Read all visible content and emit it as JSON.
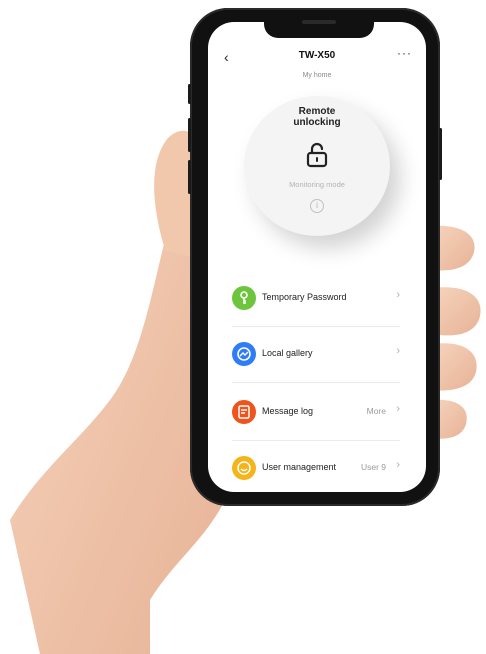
{
  "header": {
    "title": "TW-X50",
    "subtitle": "My home",
    "back_icon": "chevron-left-icon",
    "more_icon": "more-dots-icon"
  },
  "unlock": {
    "title_line1": "Remote",
    "title_line2": "unlocking",
    "status": "Monitoring mode",
    "lock_icon": "unlocked-padlock-icon",
    "info_icon": "info-icon"
  },
  "menu": {
    "items": [
      {
        "label": "Temporary Password",
        "right": "",
        "icon": "key-icon",
        "color": "#6cc53c"
      },
      {
        "label": "Local gallery",
        "right": "",
        "icon": "gallery-icon",
        "color": "#2e7cf6"
      },
      {
        "label": "Message log",
        "right": "More",
        "icon": "message-log-icon",
        "color": "#f0531c"
      },
      {
        "label": "User management",
        "right": "User 9",
        "icon": "user-icon",
        "color": "#f4b41a"
      }
    ]
  }
}
